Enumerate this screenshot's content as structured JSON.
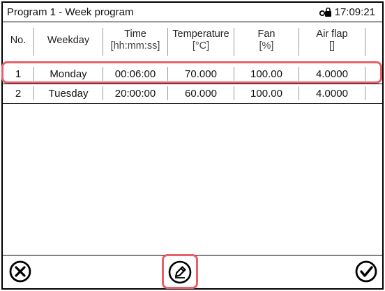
{
  "header": {
    "title": "Program 1 - Week program",
    "time": "17:09:21",
    "lock_icon": "lock-icon"
  },
  "table": {
    "columns": [
      {
        "name": "No.",
        "unit": ""
      },
      {
        "name": "Weekday",
        "unit": ""
      },
      {
        "name": "Time",
        "unit": "[hh:mm:ss]"
      },
      {
        "name": "Temperature",
        "unit": "[°C]"
      },
      {
        "name": "Fan",
        "unit": "[%]"
      },
      {
        "name": "Air flap",
        "unit": "[]"
      }
    ],
    "rows": [
      {
        "no": "1",
        "weekday": "Monday",
        "time": "00:06:00",
        "temperature": "70.000",
        "fan": "100.00",
        "air_flap": "4.0000"
      },
      {
        "no": "2",
        "weekday": "Tuesday",
        "time": "20:00:00",
        "temperature": "60.000",
        "fan": "100.00",
        "air_flap": "4.0000"
      }
    ]
  },
  "footer": {
    "cancel_icon": "cancel-icon",
    "edit_icon": "edit-pencil-icon",
    "confirm_icon": "confirm-check-icon"
  },
  "colors": {
    "highlight": "#e8606a"
  }
}
